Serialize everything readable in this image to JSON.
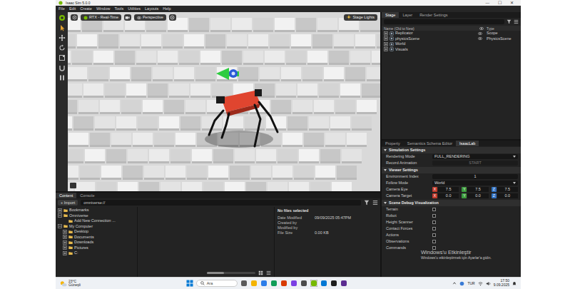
{
  "window": {
    "title": "Isaac Sim 5.0.0",
    "controls": [
      "—",
      "☐",
      "✕"
    ]
  },
  "menu": [
    "File",
    "Edit",
    "Create",
    "Window",
    "Tools",
    "Utilities",
    "Layouts",
    "Help"
  ],
  "viewport": {
    "renderer": "RTX - Real-Time",
    "camera": "Perspective",
    "lights": "Stage Lights"
  },
  "stage": {
    "tabs": [
      {
        "label": "Stage",
        "selected": true
      },
      {
        "label": "Layer",
        "selected": false
      },
      {
        "label": "Render Settings",
        "selected": false
      }
    ],
    "columns": [
      "Name (Old to New)",
      "Type"
    ],
    "rows": [
      {
        "name": "Replicator",
        "type": "Scope",
        "expanded": false,
        "visible": true
      },
      {
        "name": "physicsScene",
        "type": "PhysicsScene",
        "expanded": false,
        "visible": true
      },
      {
        "name": "World",
        "expanded": false,
        "visible": false
      },
      {
        "name": "Visuals",
        "expanded": false,
        "visible": false
      }
    ]
  },
  "property": {
    "tabs": [
      {
        "label": "Property",
        "selected": false
      },
      {
        "label": "Semantics Schema Editor",
        "selected": false
      },
      {
        "label": "IsaacLab",
        "selected": true
      }
    ],
    "sections": [
      {
        "title": "Simulation Settings",
        "expanded": true,
        "rows": [
          {
            "kind": "dropdown",
            "label": "Rendering Mode",
            "value": "FULL_RENDERING"
          },
          {
            "kind": "button",
            "label": "Record Animation",
            "value": "START",
            "disabled": true
          }
        ]
      },
      {
        "title": "Viewer Settings",
        "expanded": true,
        "rows": [
          {
            "kind": "number",
            "label": "Environment Index",
            "value": "1"
          },
          {
            "kind": "dropdown",
            "label": "Follow Mode",
            "value": "World"
          },
          {
            "kind": "vector",
            "label": "Camera Eye",
            "axes": [
              {
                "axis": "X",
                "value": "7.5",
                "color": "#c0392b"
              },
              {
                "axis": "Y",
                "value": "7.5",
                "color": "#3c9a3c"
              },
              {
                "axis": "Z",
                "value": "7.5",
                "color": "#2f6fc0"
              }
            ]
          },
          {
            "kind": "vector",
            "label": "Camera Target",
            "axes": [
              {
                "axis": "X",
                "value": "0.0",
                "color": "#c0392b"
              },
              {
                "axis": "Y",
                "value": "0.0",
                "color": "#3c9a3c"
              },
              {
                "axis": "Z",
                "value": "0.0",
                "color": "#2f6fc0"
              }
            ]
          }
        ]
      },
      {
        "title": "Scene Debug Visualization",
        "expanded": true,
        "rows": [
          {
            "kind": "checkbox",
            "label": "Terrain",
            "checked": false
          },
          {
            "kind": "checkbox",
            "label": "Robot",
            "checked": false
          },
          {
            "kind": "checkbox",
            "label": "Height Scanner",
            "checked": false
          },
          {
            "kind": "checkbox",
            "label": "Contact Forces",
            "checked": false
          },
          {
            "kind": "checkbox",
            "label": "Actions",
            "checked": false
          },
          {
            "kind": "checkbox",
            "label": "Observations",
            "checked": false
          },
          {
            "kind": "checkbox",
            "label": "Commands",
            "checked": false
          }
        ]
      }
    ]
  },
  "watermark": {
    "title": "Windows'u Etkinleştir",
    "subtitle": "Windows'u etkinleştirmek için Ayarlar'a gidin."
  },
  "content": {
    "tabs": [
      {
        "label": "Content",
        "selected": true
      },
      {
        "label": "Console",
        "selected": false
      }
    ],
    "import": "+ Import",
    "path": "omniverse://",
    "tree": [
      {
        "label": "Bookmarks",
        "expanded": false
      },
      {
        "label": "Omniverse",
        "expanded": true,
        "children": [
          {
            "label": "Add New Connection ..."
          }
        ]
      },
      {
        "label": "My Computer",
        "expanded": true,
        "children": [
          {
            "label": "Desktop",
            "expanded": false
          },
          {
            "label": "Documents",
            "expanded": false
          },
          {
            "label": "Downloads",
            "expanded": false
          },
          {
            "label": "Pictures",
            "expanded": false
          },
          {
            "label": "C:",
            "expanded": false
          }
        ]
      }
    ],
    "details": {
      "title": "No files selected",
      "fields": [
        {
          "label": "Date Modified",
          "value": "09/09/2025 05:47PM"
        },
        {
          "label": "Created by"
        },
        {
          "label": "Modified by"
        },
        {
          "label": "File Size",
          "value": "0.00 KB"
        }
      ]
    },
    "zoom": {
      "level": 0.35
    }
  },
  "taskbar": {
    "temp": "23°C",
    "condition": "Güneşli",
    "search": "Ara",
    "lang": "TUR",
    "time": "17:50",
    "date": "9.09.2025"
  }
}
